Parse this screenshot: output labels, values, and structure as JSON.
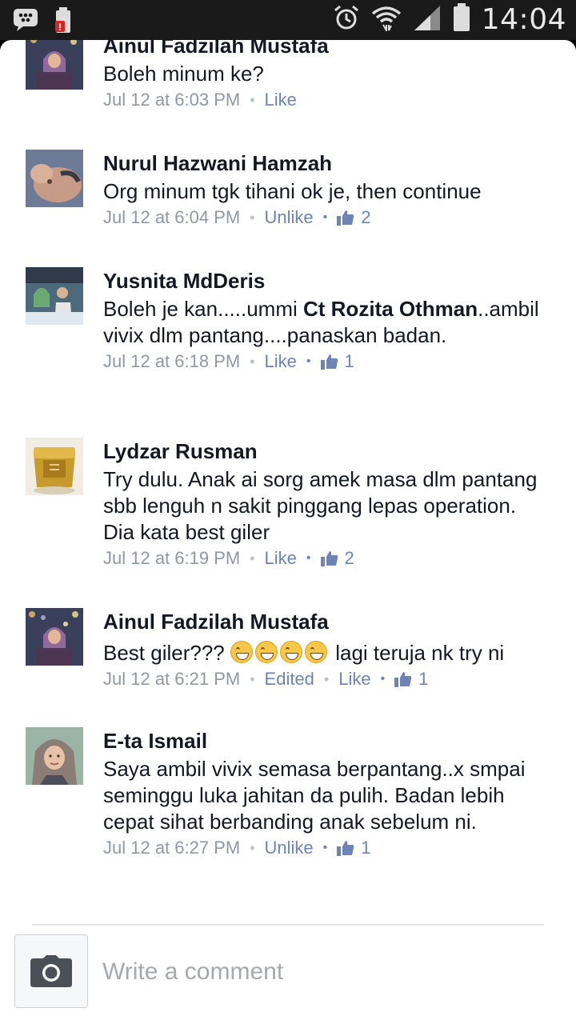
{
  "status_bar": {
    "time": "14:04",
    "icons": [
      "bbm-icon",
      "battery-alert-icon",
      "alarm-icon",
      "wifi-icon",
      "signal-icon",
      "battery-icon"
    ]
  },
  "comments": [
    {
      "name": "Ainul Fadzilah Mustafa",
      "text": "Boleh minum ke?",
      "time": "Jul 12 at 6:03 PM",
      "action": "Like",
      "likes": null
    },
    {
      "name": "Nurul Hazwani Hamzah",
      "text": "Org minum tgk tihani ok je, then continue",
      "time": "Jul 12 at 6:04 PM",
      "action": "Unlike",
      "likes": "2"
    },
    {
      "name": "Yusnita MdDeris",
      "text_pre": "Boleh je kan.....ummi ",
      "mention": "Ct Rozita Othman",
      "text_post": "..ambil vivix dlm pantang....panaskan badan.",
      "time": "Jul 12 at 6:18 PM",
      "action": "Like",
      "likes": "1"
    },
    {
      "name": "Lydzar Rusman",
      "text": "Try dulu. Anak ai sorg amek masa dlm pantang sbb lenguh n sakit pinggang lepas operation. Dia kata best giler",
      "time": "Jul 12 at 6:19 PM",
      "action": "Like",
      "likes": "2"
    },
    {
      "name": "Ainul Fadzilah Mustafa",
      "text_pre": "Best giler??? ",
      "text_post": " lagi teruja nk try ni",
      "emoji_count": 4,
      "time": "Jul 12 at 6:21 PM",
      "edited": "Edited",
      "action": "Like",
      "likes": "1"
    },
    {
      "name": "E-ta Ismail",
      "text": "Saya ambil vivix semasa berpantang..x smpai seminggu luka jahitan da pulih. Badan lebih cepat sihat berbanding anak sebelum ni.",
      "time": "Jul 12 at 6:27 PM",
      "action": "Unlike",
      "likes": "1"
    }
  ],
  "composer": {
    "placeholder": "Write a comment"
  },
  "colors": {
    "link": "#6d84b4",
    "meta": "#9197a3",
    "text": "#141823"
  }
}
